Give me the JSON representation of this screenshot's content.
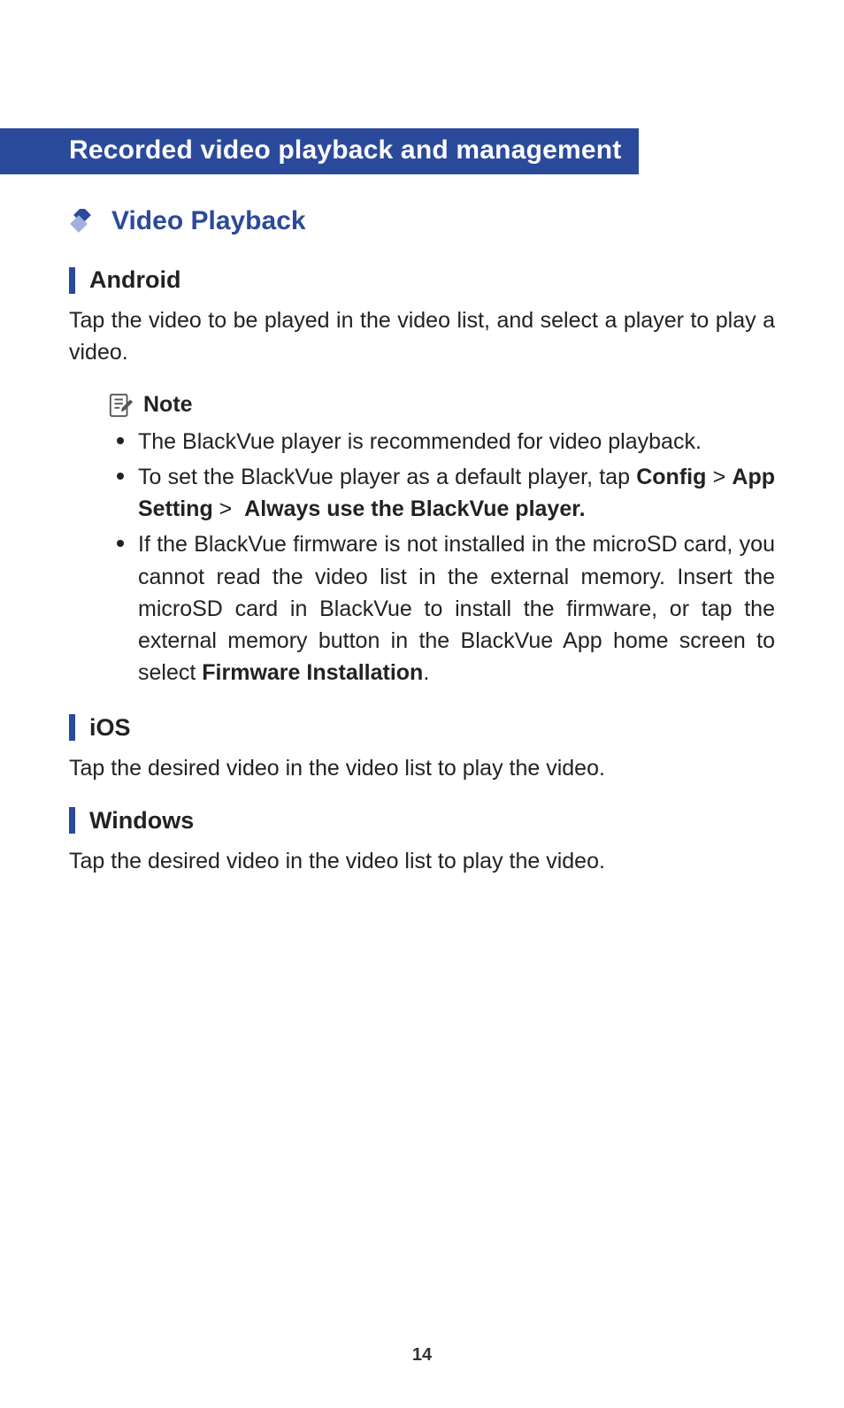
{
  "banner": "Recorded video playback and management",
  "section": {
    "title": "Video Playback"
  },
  "android": {
    "heading": "Android",
    "body": "Tap the video to be played in the video list, and select a player to play a video."
  },
  "note": {
    "label": "Note",
    "items": [
      {
        "pre": "The BlackVue player is recommended for video playback."
      },
      {
        "pre": "To set the BlackVue player as a default player, tap ",
        "bold": "Config",
        "mid1": " > ",
        "bold2": "App Setting",
        "mid2": " >  ",
        "bold3": "Always use the BlackVue player."
      },
      {
        "pre": "If the BlackVue firmware is not installed in the microSD card, you cannot read the video list in the external memory. Insert the microSD card in BlackVue to install the firmware, or tap the external memory button in the BlackVue App home screen to select ",
        "bold": "Firmware Installation",
        "post": "."
      }
    ]
  },
  "ios": {
    "heading": "iOS",
    "body": "Tap the desired video in the video list to play the video."
  },
  "windows": {
    "heading": "Windows",
    "body": "Tap the desired video in the video list to play the video."
  },
  "page_number": "14"
}
